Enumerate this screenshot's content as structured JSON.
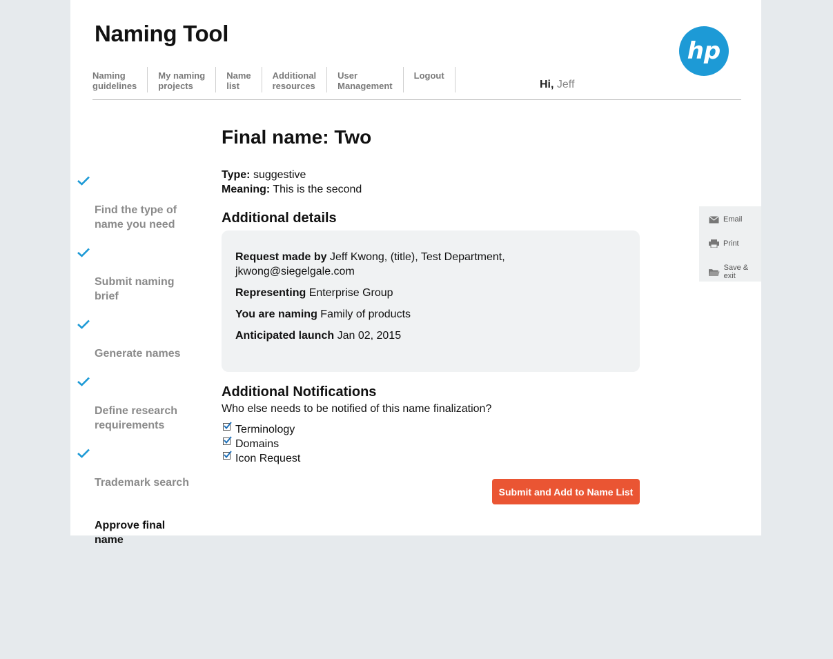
{
  "app": {
    "title": "Naming Tool",
    "brand_color": "#1d9ad6",
    "accent_color": "#ea5533"
  },
  "nav": {
    "items": [
      {
        "label": "Naming\nguidelines"
      },
      {
        "label": "My naming\nprojects"
      },
      {
        "label": "Name\nlist"
      },
      {
        "label": "Additional\nresources"
      },
      {
        "label": "User\nManagement"
      },
      {
        "label": "Logout"
      }
    ]
  },
  "greeting": {
    "prefix": "Hi,",
    "user": "Jeff"
  },
  "steps": [
    {
      "label": "Find the type of\nname you need",
      "done": true
    },
    {
      "label": "Submit naming\nbrief",
      "done": true
    },
    {
      "label": "Generate names",
      "done": true
    },
    {
      "label": "Define research\nrequirements",
      "done": true
    },
    {
      "label": "Trademark search",
      "done": true
    },
    {
      "label": "Approve final\nname",
      "done": false
    }
  ],
  "main": {
    "final_name": "Final name: Two",
    "type_label": "Type:",
    "type_value": "suggestive",
    "meaning_label": "Meaning:",
    "meaning_value": "This is the second",
    "details_heading": "Additional details",
    "details": {
      "request_label": "Request made by",
      "request_value": "Jeff Kwong, (title), Test Department, jkwong@siegelgale.com",
      "representing_label": "Representing",
      "representing_value": "Enterprise Group",
      "naming_label": "You are naming",
      "naming_value": "Family of products",
      "launch_label": "Anticipated launch",
      "launch_value": "Jan 02, 2015"
    },
    "notifications_heading": "Additional Notifications",
    "notifications_question": "Who else needs to be notified of this name finalization?",
    "notifications": [
      {
        "label": "Terminology",
        "checked": true
      },
      {
        "label": "Domains",
        "checked": true
      },
      {
        "label": "Icon Request",
        "checked": true
      }
    ],
    "submit_label": "Submit and Add to Name List"
  },
  "tools": {
    "email": "Email",
    "print": "Print",
    "save": "Save & exit"
  }
}
